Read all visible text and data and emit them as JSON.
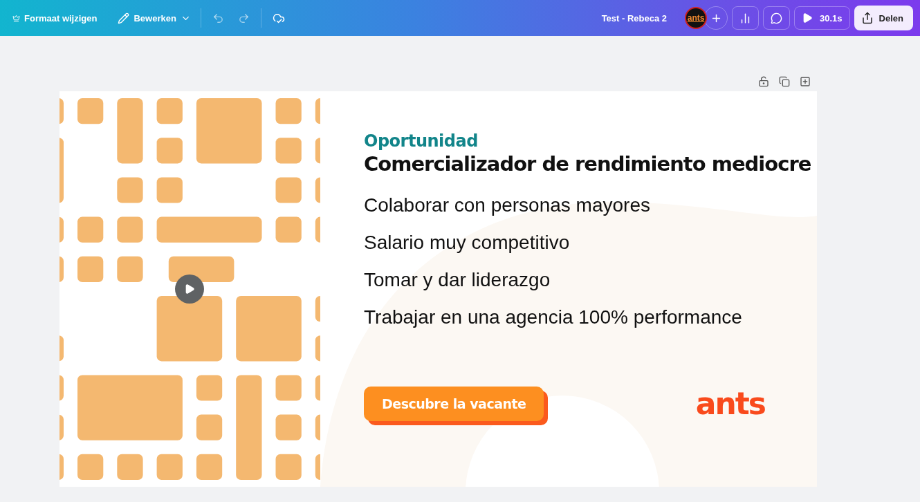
{
  "toolbar": {
    "resize_label": "Formaat wijzigen",
    "edit_label": "Bewerken",
    "title": "Test -  Rebeca 2",
    "avatar_text": "ants",
    "timer": "30.1s",
    "share_label": "Delen"
  },
  "slide": {
    "eyebrow": "Oportunidad",
    "heading": "Comercializador de rendimiento mediocre",
    "bullets": [
      "Colaborar con personas mayores",
      "Salario muy competitivo",
      "Tomar y dar liderazgo",
      "Trabajar en una agencia 100% performance"
    ],
    "cta": "Descubre la vacante",
    "logo": "ants"
  }
}
